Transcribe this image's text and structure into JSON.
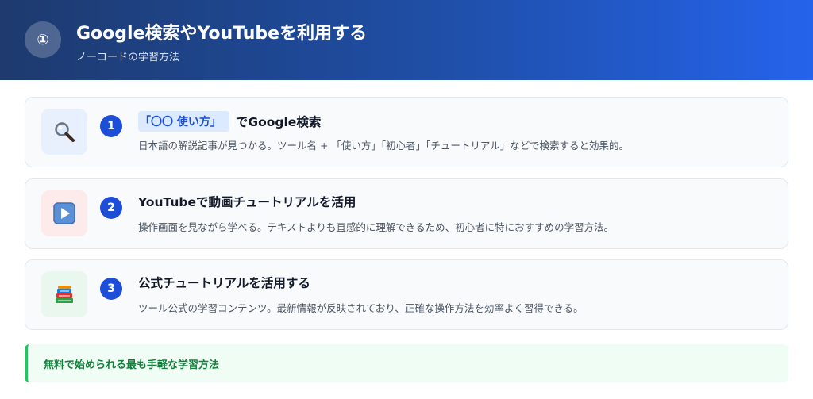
{
  "header": {
    "badge": "①",
    "title": "Google検索やYouTubeを利用する",
    "subtitle": "ノーコードの学習方法"
  },
  "cards": [
    {
      "number": "1",
      "icon": "magnifier-icon",
      "icon_bg": "#e8f0fe",
      "tag": "「〇〇 使い方」",
      "title": "でGoogle検索",
      "description": "日本語の解説記事が見つかる。ツール名 + 「使い方」「初心者」「チュートリアル」などで検索すると効果的。"
    },
    {
      "number": "2",
      "icon": "play-button-icon",
      "icon_bg": "#fdeaea",
      "title": "YouTubeで動画チュートリアルを活用",
      "description": "操作画面を見ながら学べる。テキストよりも直感的に理解できるため、初心者に特におすすめの学習方法。"
    },
    {
      "number": "3",
      "icon": "books-icon",
      "icon_bg": "#eaf7ee",
      "title": "公式チュートリアルを活用する",
      "description": "ツール公式の学習コンテンツ。最新情報が反映されており、正確な操作方法を効率よく習得できる。"
    }
  ],
  "callout": {
    "text": "無料で始められる最も手軽な学習方法"
  },
  "colors": {
    "accent": "#1d4ed8",
    "header_start": "#1e3a6e",
    "header_end": "#2563eb",
    "callout_border": "#22c55e",
    "callout_text": "#15803d"
  }
}
